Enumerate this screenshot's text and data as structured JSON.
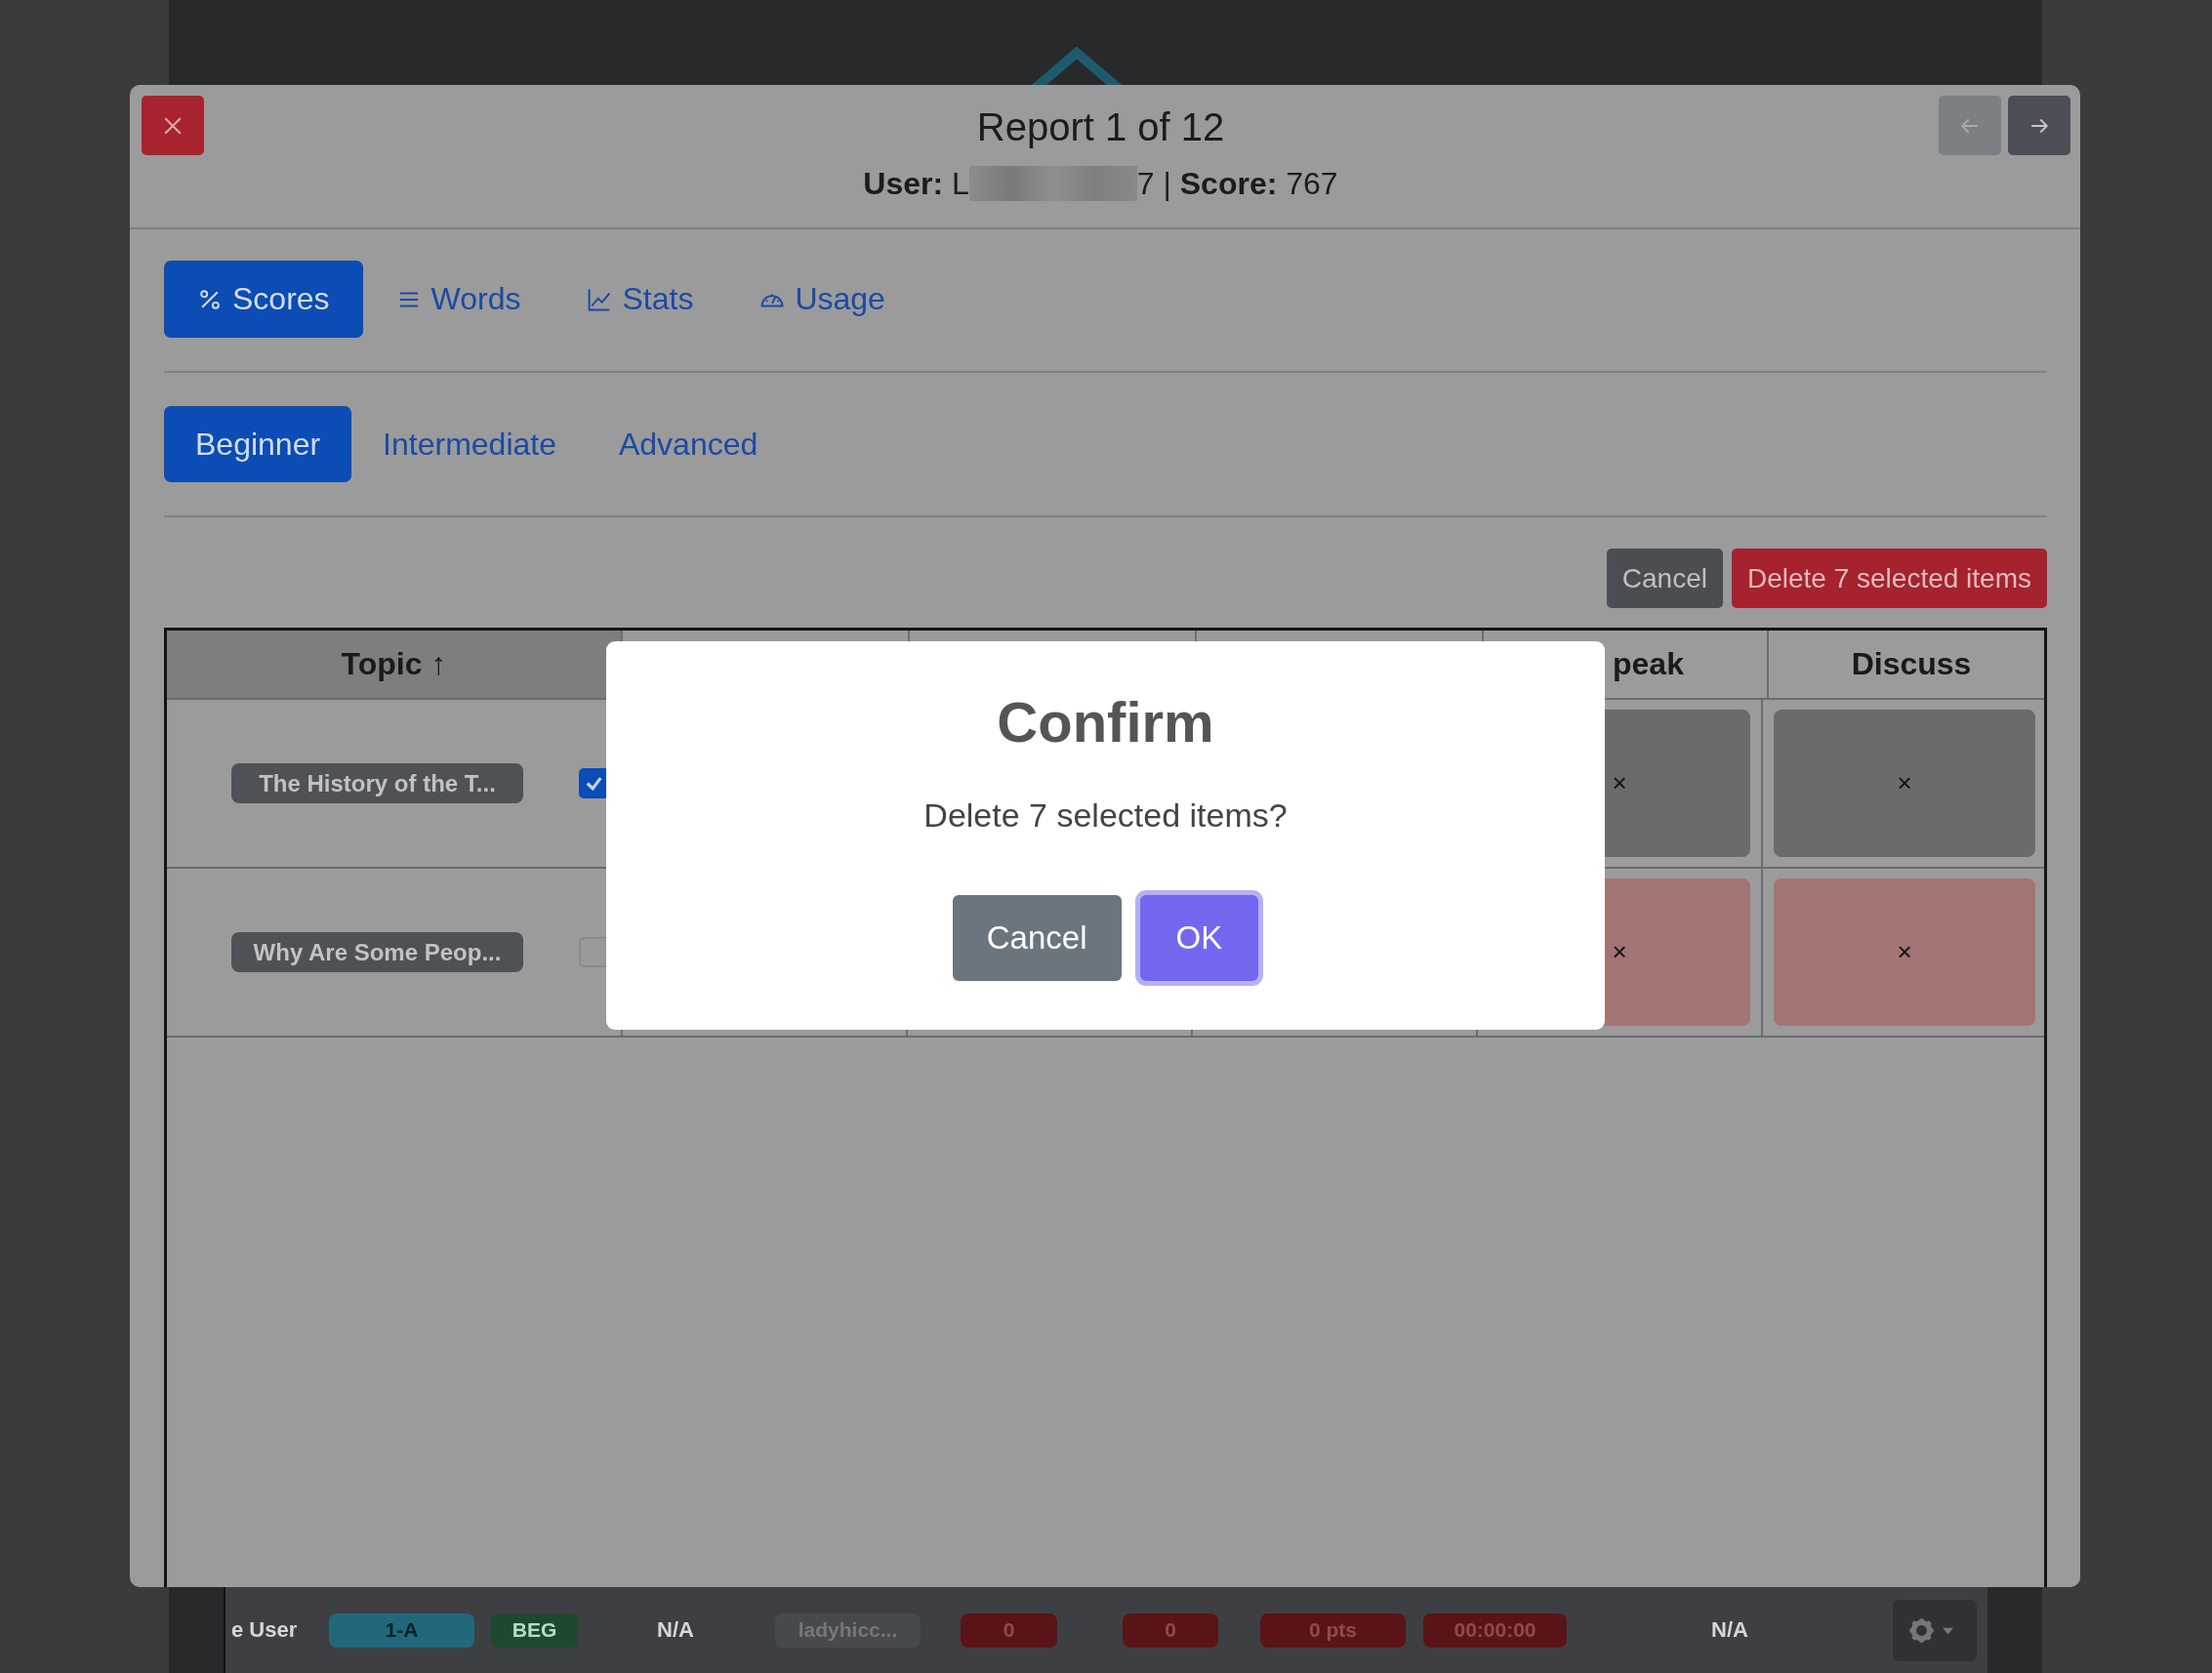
{
  "background_page": {
    "row": [
      {
        "text": "e User",
        "kind": "text"
      },
      {
        "text": "1-A",
        "kind": "badge",
        "color": "#21687c"
      },
      {
        "text": "BEG",
        "kind": "badge",
        "color": "#1d4a2d"
      },
      {
        "text": "N/A",
        "kind": "text"
      },
      {
        "text": "ladyhicc...",
        "kind": "badge",
        "color": "#46494d"
      },
      {
        "text": "0",
        "kind": "badge",
        "color": "#5a1418"
      },
      {
        "text": "0",
        "kind": "badge",
        "color": "#5a1418"
      },
      {
        "text": "0 pts",
        "kind": "badge",
        "color": "#5a1418"
      },
      {
        "text": "00:00:00",
        "kind": "badge",
        "color": "#5a1418"
      },
      {
        "text": "N/A",
        "kind": "text"
      },
      {
        "kind": "gear"
      }
    ]
  },
  "report": {
    "title": "Report 1 of 12",
    "user_line_start": "**User:** L",
    "user_line_end": "7 | **Score:** 767",
    "nav": [
      {
        "kind": "previous",
        "disabled": true
      },
      {
        "kind": "next",
        "disabled": false
      }
    ],
    "tabs": [
      {
        "label": "Scores",
        "selected": true
      },
      {
        "label": "Words",
        "selected": false
      },
      {
        "label": "Stats",
        "selected": false
      },
      {
        "label": "Usage",
        "selected": false
      }
    ],
    "levels": [
      {
        "label": "Beginner",
        "selected": true
      },
      {
        "label": "Intermediate",
        "selected": false
      },
      {
        "label": "Advanced",
        "selected": false
      }
    ],
    "actions": [
      {
        "label": "Cancel",
        "kind": "secondary"
      },
      {
        "label": "Delete 7 selected items",
        "kind": "danger"
      }
    ],
    "table": {
      "columns": [
        "Topic ↑",
        "",
        "",
        "",
        "peak",
        "Discuss"
      ],
      "rows": [
        {
          "selected": true,
          "cells": [
            "The History of the T...",
            "",
            "",
            "",
            {
              "text": "×",
              "color": "#6b6b6b"
            },
            {
              "text": "×",
              "color": "#6b6b6b"
            }
          ]
        },
        {
          "selected": false,
          "cells": [
            "Why Are Some Peop...",
            "",
            "",
            "",
            {
              "text": "×",
              "color": "#a37474"
            },
            {
              "text": "×",
              "color": "#a37474"
            }
          ]
        }
      ]
    }
  },
  "confirm": {
    "title": "Confirm",
    "message": "Delete 7 selected items?",
    "buttons": [
      {
        "label": "Cancel",
        "kind": "secondary",
        "focused": false
      },
      {
        "label": "OK",
        "kind": "primary",
        "focused": true
      }
    ]
  }
}
